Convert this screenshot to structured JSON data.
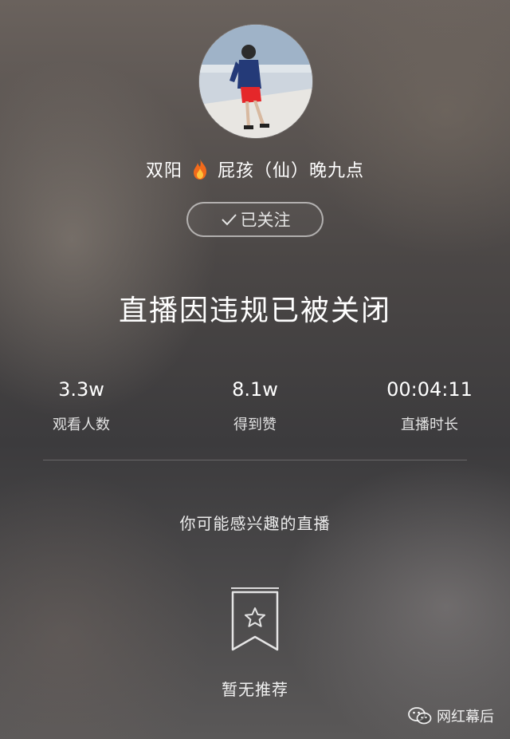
{
  "streamer": {
    "name_part1": "双阳",
    "name_icon": "fire-icon",
    "name_part2": "屁孩（仙）晚九点"
  },
  "follow_button": {
    "label": "已关注",
    "icon": "check-icon"
  },
  "headline": "直播因违规已被关闭",
  "stats": [
    {
      "value": "3.3w",
      "label": "观看人数"
    },
    {
      "value": "8.1w",
      "label": "得到赞"
    },
    {
      "value": "00:04:11",
      "label": "直播时长"
    }
  ],
  "recommend": {
    "title": "你可能感兴趣的直播",
    "empty_icon": "bookmark-star-icon",
    "empty_text": "暂无推荐"
  },
  "watermark": {
    "icon": "wechat-icon",
    "text": "网红幕后"
  },
  "colors": {
    "fire": "#f26a1b",
    "text": "#ffffff"
  }
}
